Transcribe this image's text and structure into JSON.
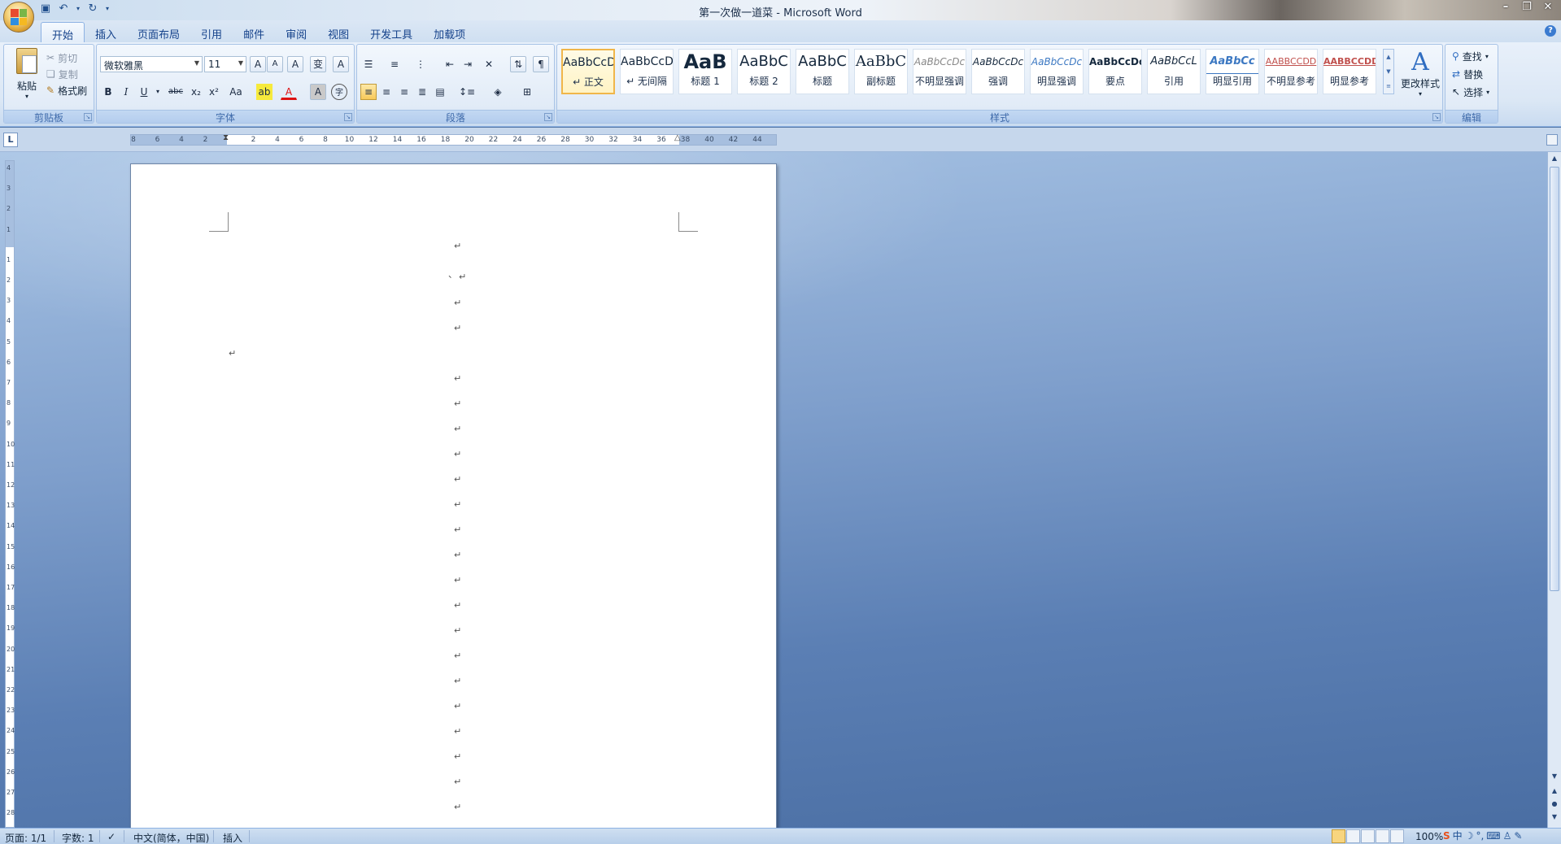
{
  "window": {
    "title": "第一次做一道菜 - Microsoft Word",
    "controls": [
      "minimize",
      "restore",
      "close"
    ]
  },
  "quick_access": [
    "save-icon",
    "undo-icon",
    "redo-icon",
    "customize-icon"
  ],
  "tabs": [
    {
      "label": "开始",
      "active": true
    },
    {
      "label": "插入"
    },
    {
      "label": "页面布局"
    },
    {
      "label": "引用"
    },
    {
      "label": "邮件"
    },
    {
      "label": "审阅"
    },
    {
      "label": "视图"
    },
    {
      "label": "开发工具"
    },
    {
      "label": "加载项"
    }
  ],
  "ribbon": {
    "clipboard": {
      "label": "剪贴板",
      "paste": "粘贴",
      "cut": "剪切",
      "copy": "复制",
      "format_painter": "格式刷"
    },
    "font": {
      "label": "字体",
      "font_name": "微软雅黑",
      "font_size": "11",
      "buttons": {
        "grow": "A",
        "shrink": "A",
        "clear": "A",
        "phonetic": "变",
        "border": "A",
        "bold": "B",
        "italic": "I",
        "underline": "U",
        "strike": "abc",
        "subscript": "x₂",
        "superscript": "x²",
        "case": "Aa",
        "highlight": "ab",
        "font_color": "A",
        "shade": "A",
        "enclose": "字"
      }
    },
    "paragraph": {
      "label": "段落"
    },
    "styles": {
      "label": "样式",
      "items": [
        {
          "sample": "AaBbCcD",
          "name": "↵ 正文",
          "selected": true
        },
        {
          "sample": "AaBbCcD",
          "name": "↵ 无间隔"
        },
        {
          "sample": "AaB",
          "name": "标题 1"
        },
        {
          "sample": "AaBbC",
          "name": "标题 2"
        },
        {
          "sample": "AaBbC",
          "name": "标题"
        },
        {
          "sample": "AaBbC",
          "name": "副标题"
        },
        {
          "sample": "AaBbCcDc",
          "name": "不明显强调"
        },
        {
          "sample": "AaBbCcDc",
          "name": "强调"
        },
        {
          "sample": "AaBbCcDc",
          "name": "明显强调"
        },
        {
          "sample": "AaBbCcDc",
          "name": "要点"
        },
        {
          "sample": "AaBbCcL",
          "name": "引用"
        },
        {
          "sample": "AaBbCc",
          "name": "明显引用"
        },
        {
          "sample": "AABBCCDD",
          "name": "不明显参考"
        },
        {
          "sample": "AABBCCDD",
          "name": "明显参考"
        }
      ],
      "change_styles": "更改样式"
    },
    "editing": {
      "label": "编辑",
      "find": "查找",
      "replace": "替换",
      "select": "选择"
    }
  },
  "ruler": {
    "corner": "L",
    "ticks": [
      "8",
      "6",
      "4",
      "2",
      "2",
      "4",
      "6",
      "8",
      "10",
      "12",
      "14",
      "16",
      "18",
      "20",
      "22",
      "24",
      "26",
      "28",
      "30",
      "32",
      "34",
      "36",
      "38",
      "40",
      "42",
      "44"
    ],
    "vticks": [
      "4",
      "3",
      "2",
      "1",
      "1",
      "2",
      "3",
      "4",
      "5",
      "6",
      "7",
      "8",
      "9",
      "10",
      "11",
      "12",
      "13",
      "14",
      "15",
      "16",
      "17",
      "18",
      "19",
      "20",
      "21",
      "22",
      "23",
      "24",
      "25",
      "26",
      "27",
      "28"
    ]
  },
  "document": {
    "mark_glyph": "↵",
    "comma": "、"
  },
  "statusbar": {
    "page": "页面: 1/1",
    "words": "字数: 1",
    "language": "中文(简体，中国)",
    "mode": "插入",
    "zoom": "100%",
    "ime": "中"
  },
  "colors": {
    "accent": "#2f6dc1",
    "ribbon_bg": "#dbe7f5",
    "workspace": "#5b7fb4",
    "selected_style": "#f0b64a"
  }
}
